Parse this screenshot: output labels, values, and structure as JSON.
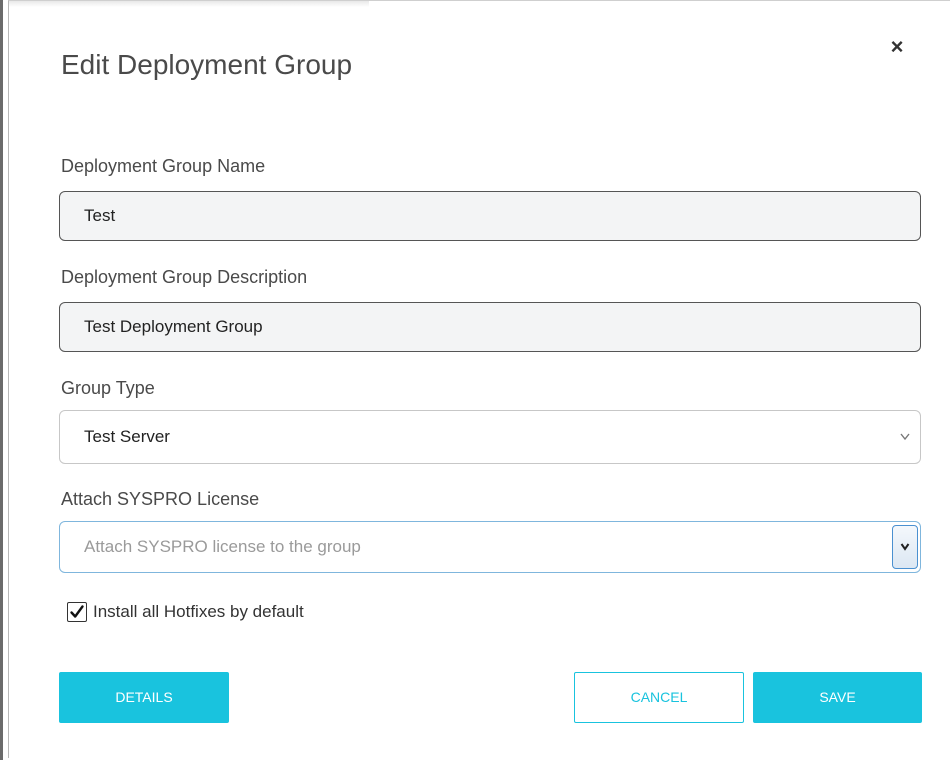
{
  "dialog": {
    "title": "Edit Deployment Group",
    "close_symbol": "×"
  },
  "fields": {
    "name": {
      "label": "Deployment Group Name",
      "value": "Test"
    },
    "description": {
      "label": "Deployment Group Description",
      "value": "Test Deployment Group"
    },
    "group_type": {
      "label": "Group Type",
      "selected": "Test Server"
    },
    "license": {
      "label": "Attach SYSPRO License",
      "placeholder": "Attach SYSPRO license to the group"
    }
  },
  "hotfixes": {
    "label": "Install all Hotfixes by default",
    "checked": true
  },
  "buttons": {
    "details": "DETAILS",
    "cancel": "CANCEL",
    "save": "SAVE"
  },
  "icons": {
    "close": "close-icon",
    "group_type_dropdown": "chevron-down-icon",
    "license_dropdown": "chevron-down-icon",
    "checkbox": "checkmark-icon"
  },
  "colors": {
    "accent": "#19c3de",
    "input_background": "#f3f4f5",
    "focus_border": "#7fb6dd"
  }
}
